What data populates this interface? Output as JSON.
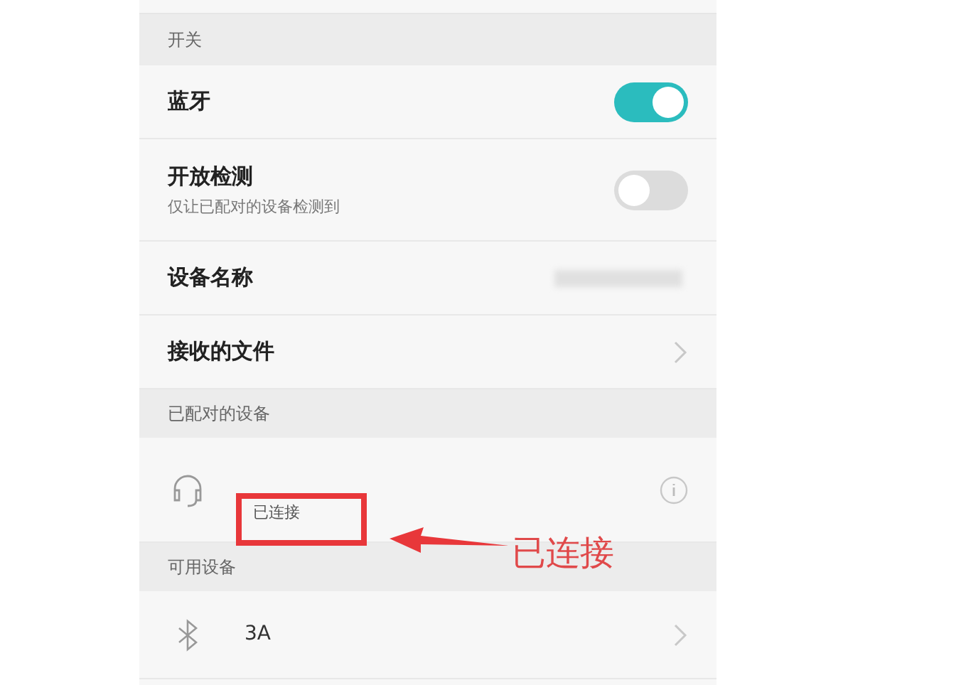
{
  "sections": [
    {
      "header": "开关",
      "rows": [
        {
          "kind": "toggle",
          "label": "蓝牙",
          "on": true
        },
        {
          "kind": "toggle",
          "label": "开放检测",
          "subtitle": "仅让已配对的设备检测到",
          "on": false
        },
        {
          "kind": "value",
          "label": "设备名称"
        },
        {
          "kind": "link",
          "label": "接收的文件"
        }
      ]
    },
    {
      "header": "已配对的设备",
      "rows": [
        {
          "kind": "paired_device",
          "status": "已连接"
        }
      ]
    },
    {
      "header": "可用设备",
      "rows": [
        {
          "kind": "available_device",
          "name_tail": "3A"
        }
      ]
    }
  ],
  "annotation": {
    "text": "已连接"
  }
}
